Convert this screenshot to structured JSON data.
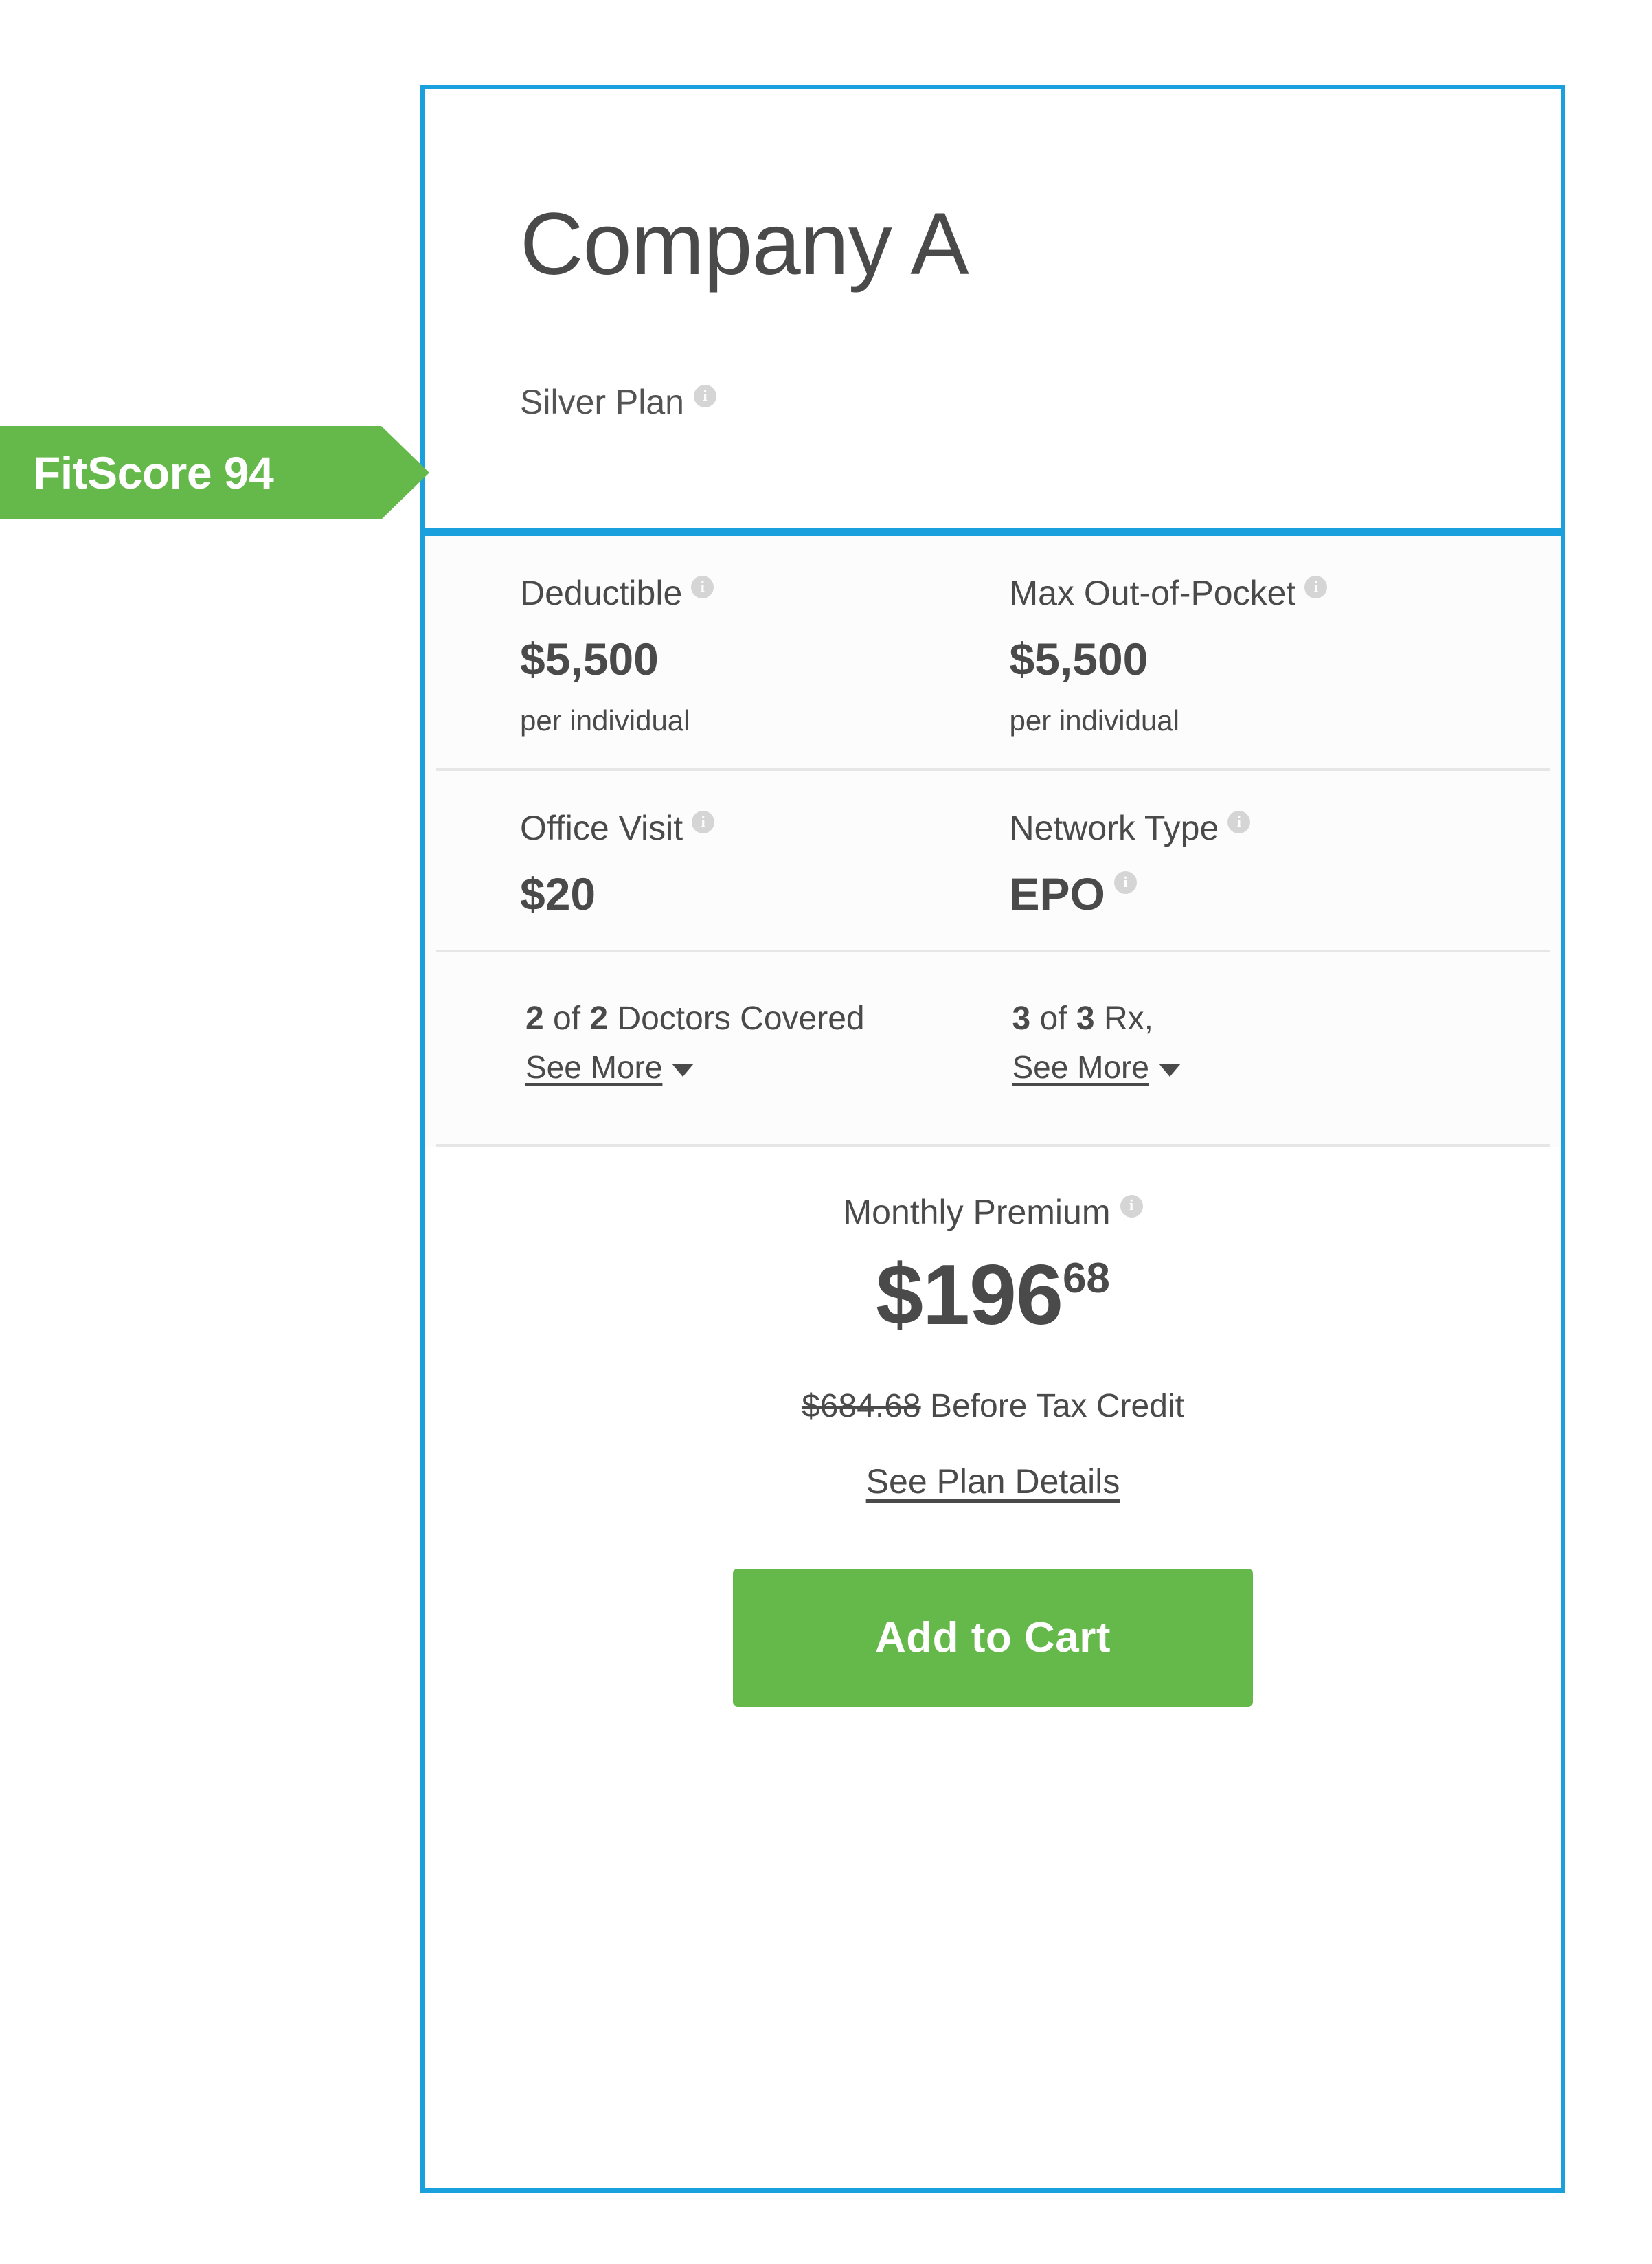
{
  "fitscore": {
    "label": "FitScore",
    "value": "94",
    "display": "FitScore 94",
    "color": "#65b94a"
  },
  "card": {
    "border_color": "#1aa0dd",
    "header": {
      "company_name": "Company A",
      "plan_tier": "Silver Plan",
      "plan_tier_info_icon": "info-icon"
    },
    "metrics": [
      {
        "label": "Deductible",
        "info_icon": "info-icon",
        "value": "$5,500",
        "sub": "per individual"
      },
      {
        "label": "Max Out-of-Pocket",
        "info_icon": "info-icon",
        "value": "$5,500",
        "sub": "per individual"
      },
      {
        "label": "Office Visit",
        "info_icon": "info-icon",
        "value": "$20",
        "sub": ""
      },
      {
        "label": "Network Type",
        "info_icon": "info-icon",
        "value": "EPO",
        "value_info_icon": "info-icon",
        "sub": ""
      }
    ],
    "coverage": {
      "doctors": {
        "covered": "2",
        "connector": " of ",
        "total": "2",
        "suffix": " Doctors Covered",
        "see_more_label": "See More",
        "caret_icon": "chevron-down-icon"
      },
      "rx": {
        "covered": "3",
        "connector": " of ",
        "total": "3",
        "suffix": " Rx,",
        "see_more_label": "See More",
        "caret_icon": "chevron-down-icon"
      }
    },
    "premium": {
      "label": "Monthly Premium",
      "info_icon": "info-icon",
      "dollars": "$196",
      "cents": "68",
      "before_credit_amount": "$684.68",
      "before_credit_suffix": " Before Tax Credit",
      "plan_details_link": "See Plan Details",
      "cart_button_label": "Add to Cart",
      "cart_button_color": "#65b94a"
    }
  }
}
